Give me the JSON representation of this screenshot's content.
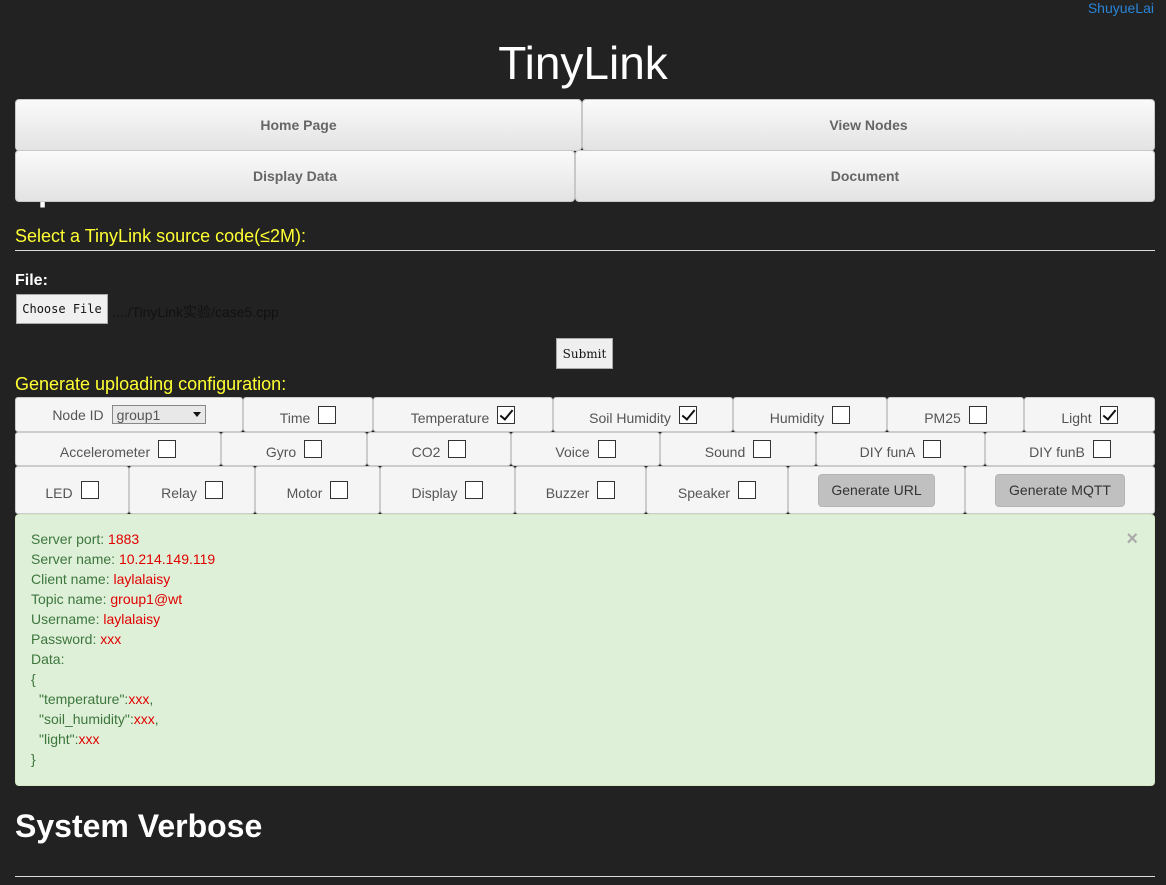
{
  "user": "ShuyueLai",
  "app_title": "TinyLink",
  "nav": {
    "home": "Home Page",
    "view_nodes": "View Nodes",
    "display_data": "Display Data",
    "document": "Document"
  },
  "upload": {
    "heading": "Upload Source Code",
    "select_label": "Select a TinyLink source code(≤2M):",
    "file_label": "File:",
    "choose_button": "Choose File",
    "file_name": "..../TinyLink实验/case5.cpp",
    "submit_button": "Submit"
  },
  "config": {
    "heading": "Generate uploading configuration:",
    "node_id_label": "Node ID",
    "node_id_value": "group1",
    "row1": [
      {
        "label": "Time",
        "checked": false
      },
      {
        "label": "Temperature",
        "checked": true
      },
      {
        "label": "Soil Humidity",
        "checked": true
      },
      {
        "label": "Humidity",
        "checked": false
      },
      {
        "label": "PM25",
        "checked": false
      },
      {
        "label": "Light",
        "checked": true
      }
    ],
    "row2": [
      {
        "label": "Accelerometer",
        "checked": false
      },
      {
        "label": "Gyro",
        "checked": false
      },
      {
        "label": "CO2",
        "checked": false
      },
      {
        "label": "Voice",
        "checked": false
      },
      {
        "label": "Sound",
        "checked": false
      },
      {
        "label": "DIY funA",
        "checked": false
      },
      {
        "label": "DIY funB",
        "checked": false
      }
    ],
    "row3": [
      {
        "label": "LED",
        "checked": false
      },
      {
        "label": "Relay",
        "checked": false
      },
      {
        "label": "Motor",
        "checked": false
      },
      {
        "label": "Display",
        "checked": false
      },
      {
        "label": "Buzzer",
        "checked": false
      },
      {
        "label": "Speaker",
        "checked": false
      }
    ],
    "generate_url": "Generate URL",
    "generate_mqtt": "Generate MQTT"
  },
  "mqtt": {
    "server_port_label": "Server port: ",
    "server_port": "1883",
    "server_name_label": "Server name: ",
    "server_name": "10.214.149.119",
    "client_name_label": "Client name: ",
    "client_name": "laylalaisy",
    "topic_name_label": "Topic name: ",
    "topic_name": "group1@wt",
    "username_label": "Username: ",
    "username": "laylalaisy",
    "password_label": "Password: ",
    "password": "xxx",
    "data_label": "Data:",
    "open_brace": "{",
    "close_brace": "}",
    "fields": [
      {
        "key": "\"temperature\":",
        "value": "xxx",
        "sep": ","
      },
      {
        "key": "\"soil_humidity\":",
        "value": "xxx",
        "sep": ","
      },
      {
        "key": "\"light\":",
        "value": "xxx",
        "sep": ""
      }
    ],
    "close_symbol": "×"
  },
  "verbose_heading": "System Verbose"
}
